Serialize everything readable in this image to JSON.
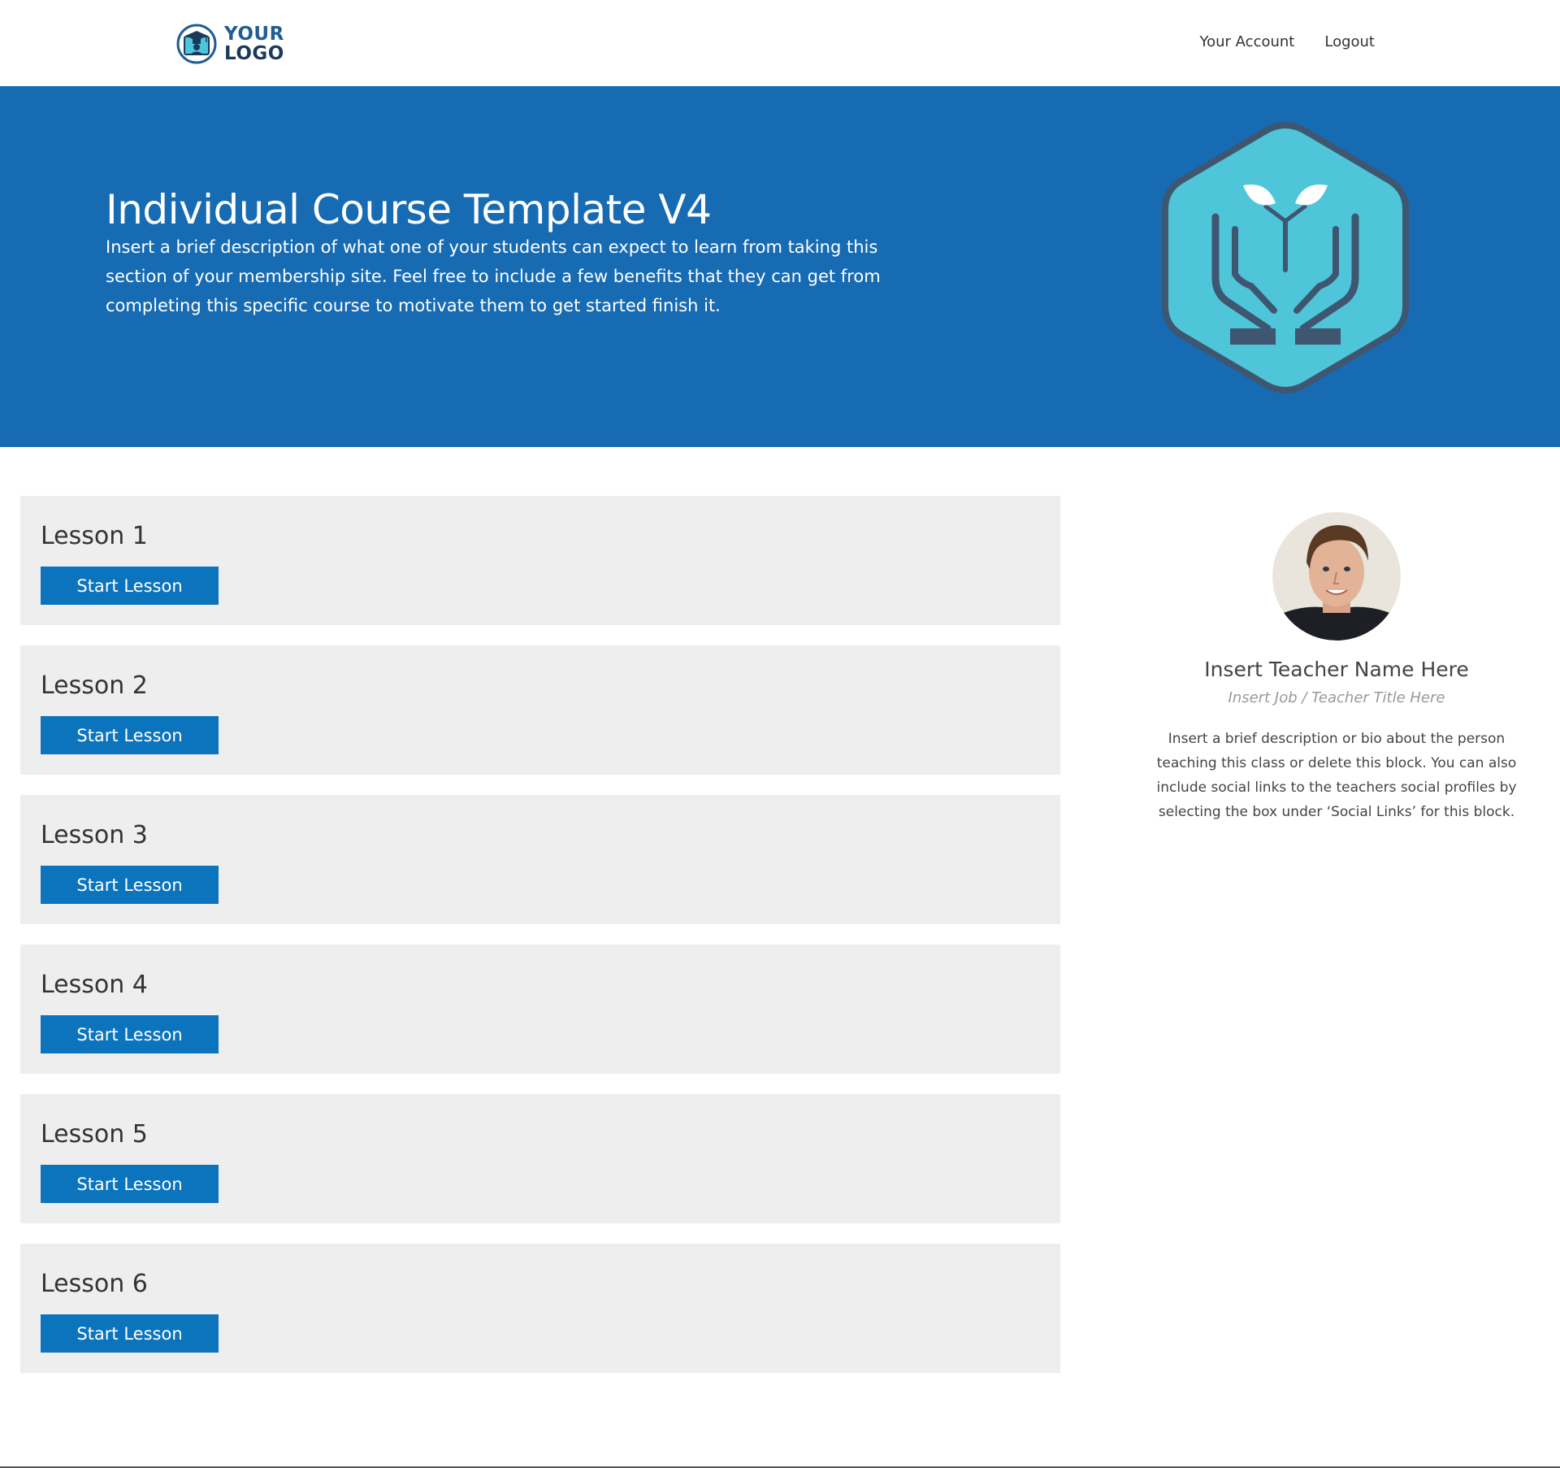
{
  "header": {
    "logo": {
      "line1": "YOUR",
      "line2": "LOGO",
      "icon": "graduation-cap-icon"
    },
    "nav": [
      {
        "label": "Your Account"
      },
      {
        "label": "Logout"
      }
    ]
  },
  "hero": {
    "title": "Individual Course Template V4",
    "description": "Insert a brief description of what one of your students can expect to learn from taking this section of your membership site. Feel free to include a few benefits that they can get from completing this specific course to motivate them to get started finish it.",
    "badge_icon": "hands-sprout-hexagon-icon",
    "colors": {
      "background": "#176bb3",
      "badge_fill": "#4ec5d9",
      "badge_stroke": "#3f5670"
    }
  },
  "lessons": [
    {
      "title": "Lesson 1",
      "button": "Start Lesson"
    },
    {
      "title": "Lesson 2",
      "button": "Start Lesson"
    },
    {
      "title": "Lesson 3",
      "button": "Start Lesson"
    },
    {
      "title": "Lesson 4",
      "button": "Start Lesson"
    },
    {
      "title": "Lesson 5",
      "button": "Start Lesson"
    },
    {
      "title": "Lesson 6",
      "button": "Start Lesson"
    }
  ],
  "teacher": {
    "name": "Insert Teacher Name Here",
    "title": "Insert Job / Teacher Title Here",
    "bio": "Insert a brief description or bio about the person teaching this class or delete this block. You can also include social links to the teachers social profiles by selecting the box under ‘Social Links’ for this block.",
    "avatar": "teacher-avatar"
  },
  "colors": {
    "button": "#0b74bd",
    "card": "#eeeeee"
  }
}
